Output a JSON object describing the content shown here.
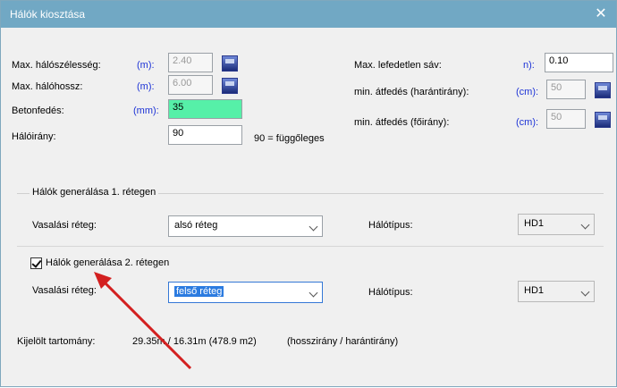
{
  "window": {
    "title": "Hálók kiosztása",
    "close_glyph": "✕"
  },
  "params_left": {
    "max_width_label": "Max. hálószélesség:",
    "max_width_unit": "(m):",
    "max_width_value": "2.40",
    "max_length_label": "Max. hálóhossz:",
    "max_length_unit": "(m):",
    "max_length_value": "6.00",
    "cover_label": "Betonfedés:",
    "cover_unit": "(mm):",
    "cover_value": "35",
    "direction_label": "Hálóirány:",
    "direction_value": "90",
    "direction_hint": "90 = függőleges"
  },
  "params_right": {
    "uncovered_label": "Max. lefedetlen sáv:",
    "uncovered_unit": "n):",
    "uncovered_value": "0.10",
    "overlap_cross_label": "min. átfedés (harántirány):",
    "overlap_cross_unit": "(cm):",
    "overlap_cross_value": "50",
    "overlap_main_label": "min. átfedés (főirány):",
    "overlap_main_unit": "(cm):",
    "overlap_main_value": "50"
  },
  "layer1": {
    "title": "Hálók generálása 1. rétegen",
    "rebar_layer_label": "Vasalási réteg:",
    "rebar_layer_value": "alsó réteg",
    "mesh_type_label": "Hálótípus:",
    "mesh_type_value": "HD1"
  },
  "layer2": {
    "checkbox_label": "Hálók generálása 2. rétegen",
    "checked": true,
    "rebar_layer_label": "Vasalási réteg:",
    "rebar_layer_value": "felső réteg",
    "mesh_type_label": "Hálótípus:",
    "mesh_type_value": "HD1"
  },
  "footer": {
    "range_label": "Kijelölt tartomány:",
    "range_value": "29.35m / 16.31m (478.9 m2)",
    "range_hint": "(hosszirány / harántirány)"
  },
  "colors": {
    "titlebar": "#71a8c4",
    "unit_text": "#1d33d6",
    "highlight_field": "#56f0a8",
    "annotation_arrow": "#d32020"
  }
}
